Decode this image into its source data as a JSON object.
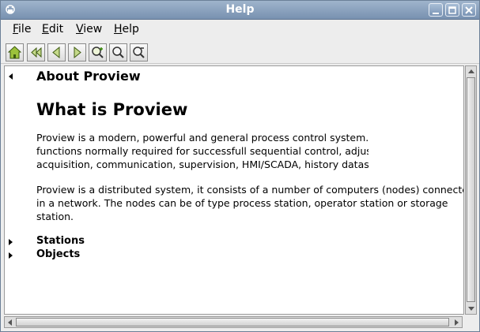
{
  "window": {
    "title": "Help",
    "controls": [
      "minimize-icon",
      "maximize-icon",
      "close-icon"
    ]
  },
  "menubar": {
    "items": [
      {
        "mnemonic": "F",
        "rest": "ile"
      },
      {
        "mnemonic": "E",
        "rest": "dit"
      },
      {
        "mnemonic": "V",
        "rest": "iew"
      },
      {
        "mnemonic": "H",
        "rest": "elp"
      }
    ]
  },
  "toolbar": {
    "buttons": [
      "home-icon",
      "back-to-start-icon",
      "previous-icon",
      "next-icon",
      "zoom-in-icon",
      "zoom-reset-icon",
      "zoom-out-icon"
    ]
  },
  "content": {
    "about_heading": "About Proview",
    "main_heading": "What is Proview",
    "paragraph1": [
      "Proview is a modern, powerful and general process control system. It",
      "functions normally required for successfull sequential control, adjustm",
      "acquisition, communication, supervision, HMI/SCADA, history datastor"
    ],
    "paragraph2": [
      "Proview is a distributed system, it consists of a number of computers (nodes) connected",
      "in a network. The nodes can be of type process station, operator station or storage",
      "station."
    ],
    "links": [
      {
        "label": "Stations"
      },
      {
        "label": "Objects"
      }
    ]
  },
  "colors": {
    "titlebar": "#8aa2c0",
    "toolbar_icon_green": "#9cc23b",
    "content_background": "#ffffff"
  }
}
